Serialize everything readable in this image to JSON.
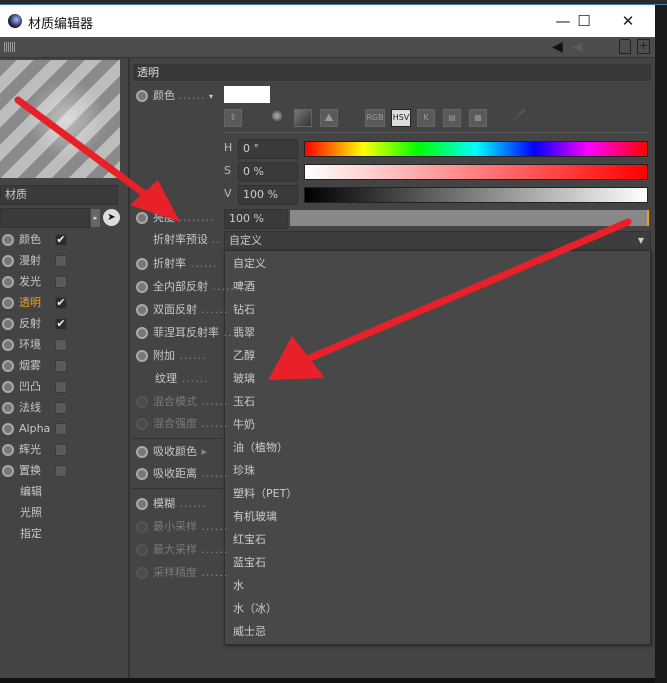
{
  "window": {
    "title": "材质编辑器",
    "minimize": "—",
    "maximize": "☐",
    "close": "✕"
  },
  "toolbar": {
    "icons": [
      "grip-icon",
      "back-arrow-icon",
      "forward-arrow-icon",
      "lock-icon",
      "new-window-icon"
    ]
  },
  "left": {
    "material_name": "材质",
    "channels": [
      {
        "label": "颜色",
        "checked": true
      },
      {
        "label": "漫射",
        "checked": false
      },
      {
        "label": "发光",
        "checked": false
      },
      {
        "label": "透明",
        "checked": true,
        "active": true
      },
      {
        "label": "反射",
        "checked": true
      },
      {
        "label": "环境",
        "checked": false
      },
      {
        "label": "烟雾",
        "checked": false
      },
      {
        "label": "凹凸",
        "checked": false
      },
      {
        "label": "法线",
        "checked": false
      },
      {
        "label": "Alpha",
        "checked": false
      },
      {
        "label": "辉光",
        "checked": false
      },
      {
        "label": "置换",
        "checked": false
      }
    ],
    "extras": [
      "编辑",
      "光照",
      "指定"
    ]
  },
  "panel": {
    "section": "透明",
    "color_label": "颜色",
    "color_value": "#ffffff",
    "mode_buttons": [
      "RGB",
      "HSV",
      "K"
    ],
    "active_mode": "HSV",
    "h": {
      "label": "H",
      "value": "0 °"
    },
    "s": {
      "label": "S",
      "value": "0 %"
    },
    "v": {
      "label": "V",
      "value": "100 %"
    },
    "brightness": {
      "label": "亮度",
      "value": "100 %",
      "fraction": 1.0
    },
    "ior_preset": {
      "label": "折射率预设",
      "value": "自定义"
    },
    "props": [
      "折射率",
      "全内部反射",
      "双面反射",
      "菲涅耳反射率",
      "附加"
    ],
    "texture": "纹理",
    "blend_mode": "混合模式",
    "blend_strength": "混合强度",
    "absorb_color": "吸收颜色",
    "absorb_distance": "吸收距离",
    "blur": "模糊",
    "min_samples": "最小采样",
    "max_samples": "最大采样",
    "sample_accuracy": "采样精度"
  },
  "dropdown": {
    "options": [
      "自定义",
      "啤酒",
      "钻石",
      "翡翠",
      "乙醇",
      "玻璃",
      "玉石",
      "牛奶",
      "油（植物）",
      "珍珠",
      "塑料（PET）",
      "有机玻璃",
      "红宝石",
      "蓝宝石",
      "水",
      "水（冰）",
      "威士忌"
    ]
  },
  "colors": {
    "accent": "#f0a020",
    "arrow": "#e8202a"
  }
}
